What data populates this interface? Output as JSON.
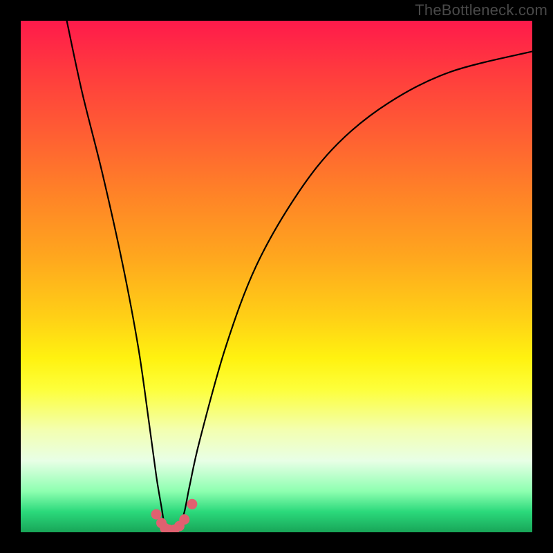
{
  "watermark": "TheBottleneck.com",
  "chart_data": {
    "type": "line",
    "title": "",
    "xlabel": "",
    "ylabel": "",
    "xlim": [
      0,
      100
    ],
    "ylim": [
      0,
      100
    ],
    "series": [
      {
        "name": "bottleneck-curve",
        "x": [
          9,
          12,
          16,
          20,
          23,
          25,
          26.5,
          27.5,
          28.2,
          29,
          30,
          31,
          32,
          33,
          35,
          40,
          46,
          54,
          62,
          72,
          84,
          100
        ],
        "y": [
          100,
          86,
          70,
          52,
          36,
          22,
          11,
          5,
          1,
          0,
          0,
          1,
          4,
          9,
          18,
          36,
          52,
          66,
          76,
          84,
          90,
          94
        ]
      }
    ],
    "markers": [
      {
        "x": 26.5,
        "y": 3.5
      },
      {
        "x": 27.5,
        "y": 1.8
      },
      {
        "x": 28.2,
        "y": 0.8
      },
      {
        "x": 29.0,
        "y": 0.5
      },
      {
        "x": 30.0,
        "y": 0.5
      },
      {
        "x": 31.0,
        "y": 1.2
      },
      {
        "x": 32.0,
        "y": 2.5
      },
      {
        "x": 33.5,
        "y": 5.5
      }
    ],
    "marker_color": "#e06070",
    "gradient_stops": [
      {
        "pos": 0,
        "color": "#ff1a4b"
      },
      {
        "pos": 50,
        "color": "#ffb020"
      },
      {
        "pos": 70,
        "color": "#fff210"
      },
      {
        "pos": 100,
        "color": "#18a558"
      }
    ]
  }
}
